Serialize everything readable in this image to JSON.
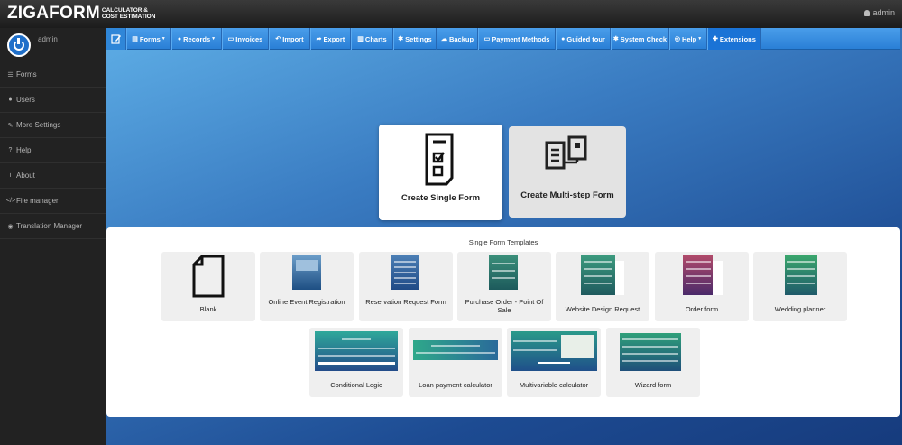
{
  "app": {
    "logo_main": "ZIGAFORM",
    "logo_sub": "CALCULATOR & COST ESTIMATION",
    "user_top": "admin"
  },
  "sidebar": {
    "username": "admin",
    "items": [
      {
        "label": "Forms",
        "icon": "list-icon"
      },
      {
        "label": "Users",
        "icon": "user-icon"
      },
      {
        "label": "More Settings",
        "icon": "wrench-icon"
      },
      {
        "label": "Help",
        "icon": "question-icon"
      },
      {
        "label": "About",
        "icon": "info-icon"
      },
      {
        "label": "File manager",
        "icon": "code-icon"
      },
      {
        "label": "Translation Manager",
        "icon": "globe-icon"
      }
    ]
  },
  "toolbar": {
    "items": [
      {
        "label": "Forms",
        "icon": "file-icon",
        "caret": true
      },
      {
        "label": "Records",
        "icon": "info-circle-icon",
        "caret": true
      },
      {
        "label": "Invoices",
        "icon": "money-icon"
      },
      {
        "label": "Import",
        "icon": "undo-icon"
      },
      {
        "label": "Export",
        "icon": "share-icon"
      },
      {
        "label": "Charts",
        "icon": "chart-icon"
      },
      {
        "label": "Settings",
        "icon": "gear-icon"
      },
      {
        "label": "Backup",
        "icon": "cloud-icon"
      },
      {
        "label": "Payment Methods",
        "icon": "money-icon"
      },
      {
        "label": "Guided tour",
        "icon": "info-circle-icon"
      },
      {
        "label": "System Check",
        "icon": "gear-icon"
      },
      {
        "label": "Help",
        "icon": "life-ring-icon",
        "caret": true
      },
      {
        "label": "Extensions",
        "icon": "puzzle-icon"
      }
    ]
  },
  "hero": {
    "single_label": "Create Single Form",
    "multi_label": "Create Multi-step Form"
  },
  "templates": {
    "title": "Single Form Templates",
    "row1": [
      {
        "label": "Blank"
      },
      {
        "label": "Online Event Registration"
      },
      {
        "label": "Reservation Request Form"
      },
      {
        "label": "Purchase Order - Point Of Sale"
      },
      {
        "label": "Website Design Request"
      },
      {
        "label": "Order form"
      },
      {
        "label": "Wedding planner"
      }
    ],
    "row2": [
      {
        "label": "Conditional Logic"
      },
      {
        "label": "Loan payment calculator"
      },
      {
        "label": "Multivariable calculator"
      },
      {
        "label": "Wizard form"
      }
    ]
  },
  "colors": {
    "toolbar": "#2a7fd6",
    "sidebar": "#222222",
    "active_tab": "#1a73d6"
  }
}
